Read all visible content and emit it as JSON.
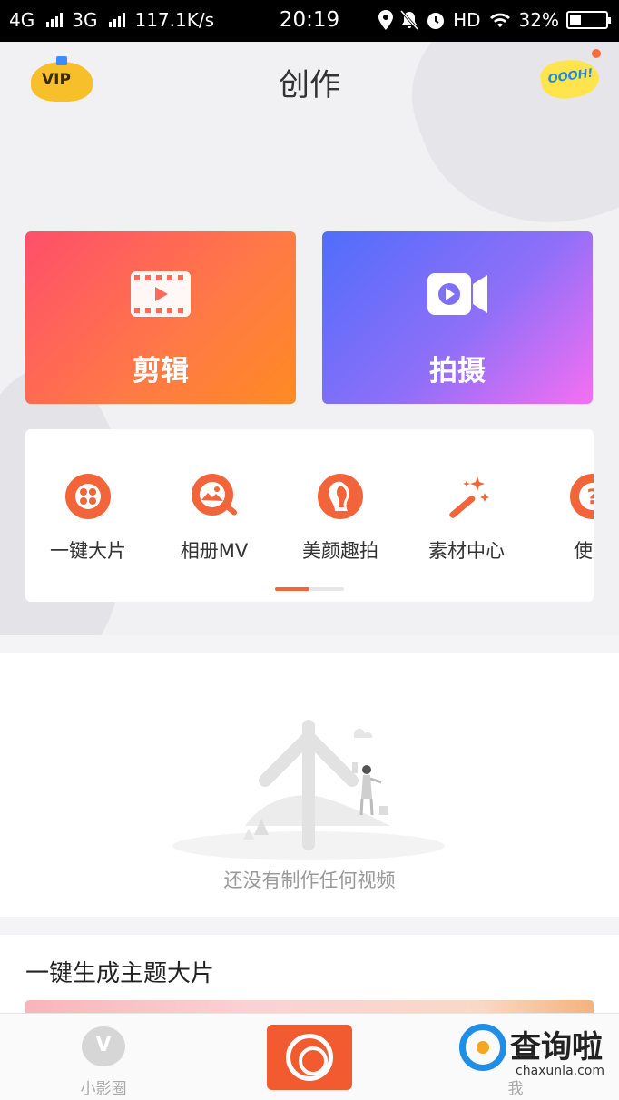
{
  "status_bar": {
    "network1": "4G",
    "network2": "3G",
    "speed": "117.1K/s",
    "time": "20:19",
    "hd": "HD",
    "battery": "32%"
  },
  "header": {
    "title": "创作",
    "vip_label": "VIP",
    "comic_label": "OOOH!"
  },
  "cards": {
    "edit_label": "剪辑",
    "shoot_label": "拍摄"
  },
  "tools": [
    {
      "label": "一键大片",
      "icon": "film-reel-icon"
    },
    {
      "label": "相册MV",
      "icon": "album-mv-icon"
    },
    {
      "label": "美颜趣拍",
      "icon": "beauty-face-icon"
    },
    {
      "label": "素材中心",
      "icon": "magic-wand-icon"
    },
    {
      "label": "使用",
      "icon": "help-icon"
    }
  ],
  "page_indicator": {
    "current": 1,
    "total": 2
  },
  "empty_state": {
    "message": "还没有制作任何视频"
  },
  "section": {
    "title": "一键生成主题大片"
  },
  "bottom_nav": {
    "left_icon_letter": "V",
    "left_label": "小影圈",
    "right_label": "我"
  },
  "watermark": {
    "big": "查询啦",
    "small": "chaxunla.com"
  },
  "colors": {
    "accent": "#f25a2f",
    "edit_gradient": [
      "#fe4f6b",
      "#ff8a22"
    ],
    "shoot_gradient": [
      "#4f6efb",
      "#f66ff2"
    ]
  }
}
